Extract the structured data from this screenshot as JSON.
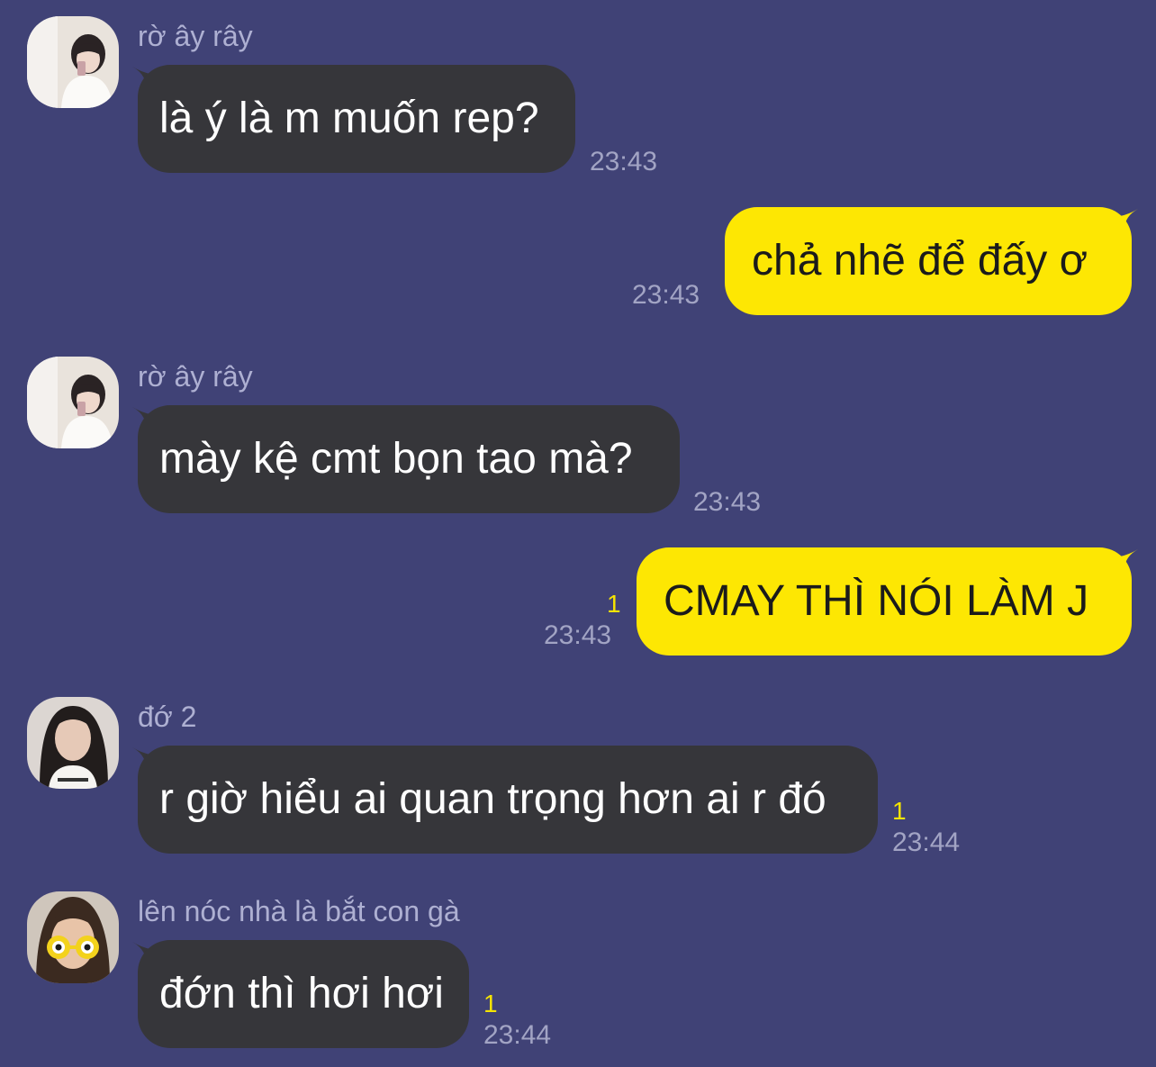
{
  "colors": {
    "background": "#404276",
    "incoming_bubble": "#36363a",
    "outgoing_bubble": "#fde703",
    "unread_count": "#f5e400"
  },
  "messages": [
    {
      "direction": "incoming",
      "sender": "rờ ây rây",
      "avatar": "avatar-girl-mirror-selfie",
      "text": "là ý là m muốn rep?",
      "time": "23:43"
    },
    {
      "direction": "outgoing",
      "text": "chả nhẽ để đấy ơ",
      "time": "23:43"
    },
    {
      "direction": "incoming",
      "sender": "rờ ây rây",
      "avatar": "avatar-girl-mirror-selfie",
      "text": "mày kệ cmt bọn tao mà?",
      "time": "23:43"
    },
    {
      "direction": "outgoing",
      "text": "CMAY THÌ NÓI LÀM J",
      "time": "23:43",
      "unread": "1"
    },
    {
      "direction": "incoming",
      "sender": "đớ 2",
      "avatar": "avatar-girl-portrait",
      "text": "r giờ hiểu ai quan trọng hơn ai r đó",
      "time": "23:44",
      "unread": "1"
    },
    {
      "direction": "incoming",
      "sender": "lên nóc nhà là bắt con gà",
      "avatar": "avatar-girl-yellow-glasses",
      "text": "đớn thì hơi hơi",
      "time": "23:44",
      "unread": "1"
    }
  ]
}
